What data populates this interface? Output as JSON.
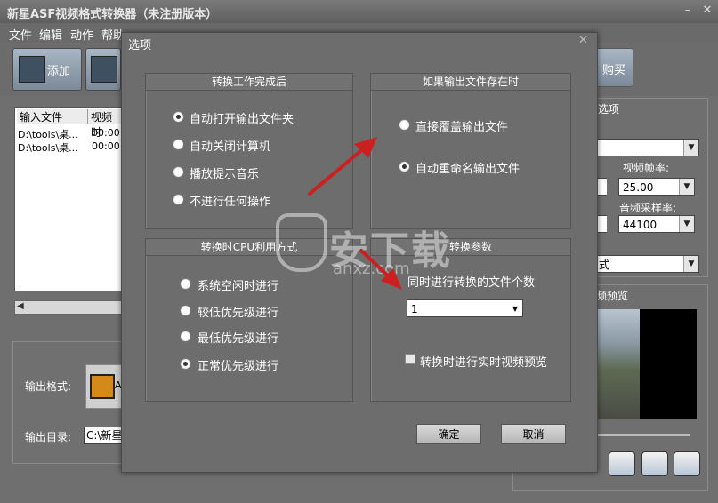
{
  "window": {
    "title": "新星ASF视频格式转换器（未注册版本）"
  },
  "menu": [
    "文件",
    "编辑",
    "动作",
    "帮助"
  ],
  "toolbar": {
    "add_label": "添加",
    "buy_label": "购买"
  },
  "filelist": {
    "headers": [
      "输入文件",
      "视频时"
    ],
    "rows": [
      [
        "D:\\tools\\桌...",
        "00:00:"
      ],
      [
        "D:\\tools\\桌...",
        "00:00:"
      ]
    ]
  },
  "bottom": {
    "format_label": "输出格式:",
    "format_value": "A",
    "dir_label": "输出目录:",
    "dir_value": "C:\\新星"
  },
  "right": {
    "settings_header": "置选项",
    "framerate_label": "视频帧率:",
    "framerate_value": "25.00",
    "samplerate_label": "音频采样率:",
    "samplerate_value": "44100",
    "mode_value": "式",
    "preview_header": "频预览"
  },
  "dialog": {
    "title": "选项",
    "group1": {
      "title": "转换工作完成后",
      "options": [
        "自动打开输出文件夹",
        "自动关闭计算机",
        "播放提示音乐",
        "不进行任何操作"
      ],
      "selected": 0
    },
    "group2": {
      "title": "如果输出文件存在时",
      "options": [
        "直接覆盖输出文件",
        "自动重命名输出文件"
      ],
      "selected": 1
    },
    "group3": {
      "title": "转换时CPU利用方式",
      "options": [
        "系统空闲时进行",
        "较低优先级进行",
        "最低优先级进行",
        "正常优先级进行"
      ],
      "selected": 3
    },
    "group4": {
      "title": "转换参数",
      "concurrent_label": "同时进行转换的文件个数",
      "concurrent_value": "1",
      "preview_checkbox_label": "转换时进行实时视频预览",
      "preview_checked": false
    },
    "ok_label": "确定",
    "cancel_label": "取消"
  },
  "watermark": {
    "text": "安下载",
    "sub": "anxz.com"
  },
  "colors": {
    "arrow": "#cc1f1f",
    "dialog_bg": "#6d6d6d"
  }
}
